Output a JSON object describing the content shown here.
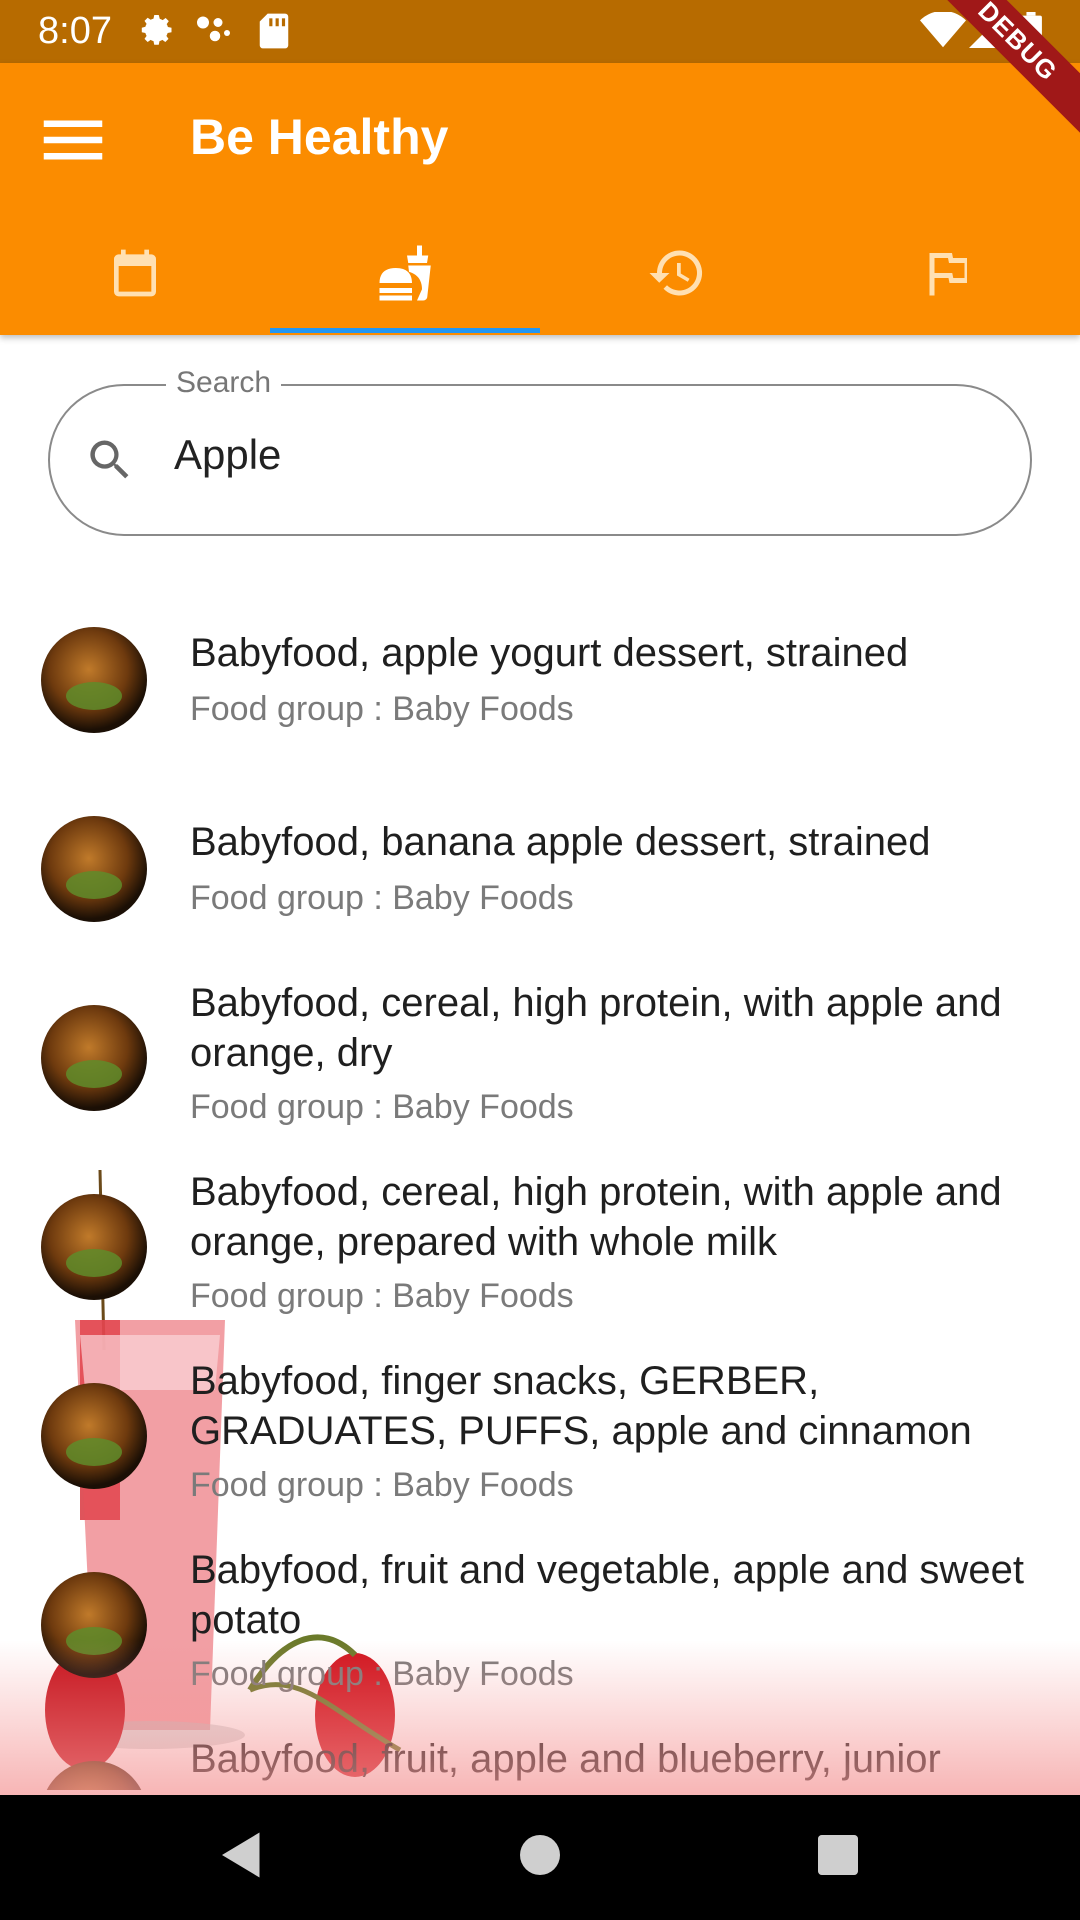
{
  "status_bar": {
    "time": "8:07"
  },
  "debug_banner": "DEBUG",
  "app_bar": {
    "title": "Be Healthy",
    "tabs": [
      {
        "icon": "calendar-icon"
      },
      {
        "icon": "fastfood-icon",
        "selected": true
      },
      {
        "icon": "history-icon"
      },
      {
        "icon": "flag-icon"
      }
    ]
  },
  "search": {
    "label": "Search",
    "value": "Apple"
  },
  "results": [
    {
      "title": "Babyfood, apple yogurt dessert, strained",
      "subtitle": "Food group : Baby Foods"
    },
    {
      "title": "Babyfood, banana apple dessert, strained",
      "subtitle": "Food group : Baby Foods"
    },
    {
      "title": "Babyfood, cereal, high protein, with apple and orange, dry",
      "subtitle": "Food group : Baby Foods"
    },
    {
      "title": "Babyfood, cereal, high protein, with apple and orange, prepared with whole milk",
      "subtitle": "Food group : Baby Foods"
    },
    {
      "title": "Babyfood, finger snacks, GERBER, GRADUATES, PUFFS, apple and cinnamon",
      "subtitle": "Food group : Baby Foods"
    },
    {
      "title": "Babyfood, fruit and vegetable, apple and sweet potato",
      "subtitle": "Food group : Baby Foods"
    },
    {
      "title": "Babyfood, fruit, apple and blueberry, junior",
      "subtitle": ""
    }
  ],
  "colors": {
    "app_bar": "#fb8c00",
    "status_bar": "#b76b00",
    "tab_indicator": "#2196f3"
  }
}
